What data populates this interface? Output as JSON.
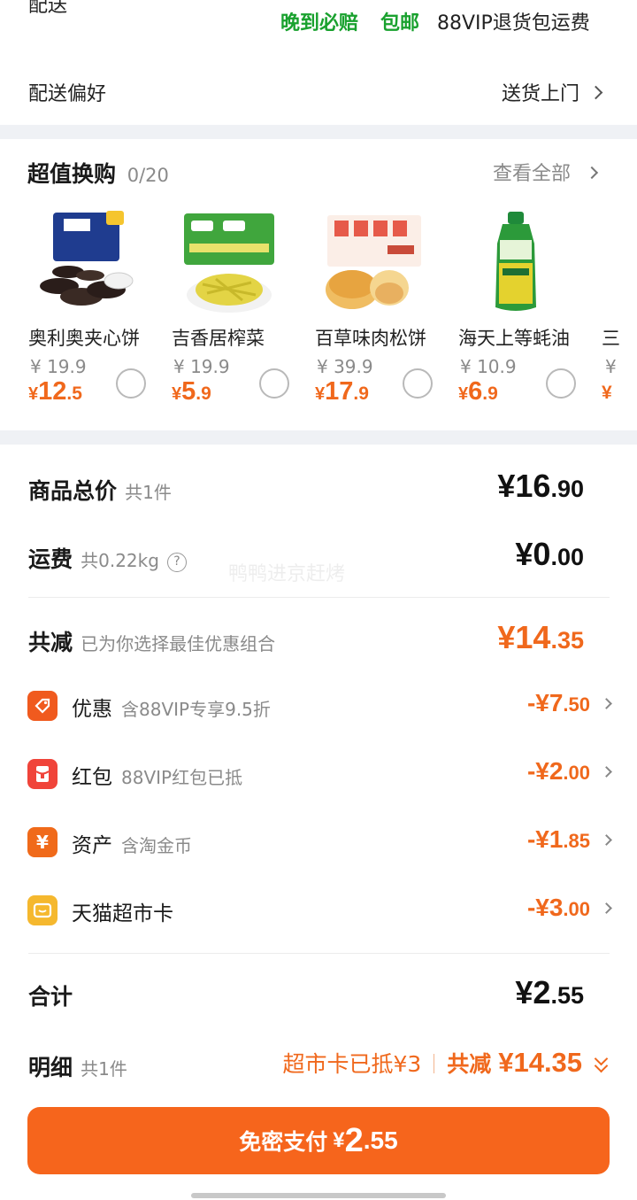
{
  "delivery": {
    "label_cut": "配送",
    "tag1": "晚到必赔",
    "tag2": "包邮",
    "tag3": "88VIP退货包运费",
    "pref_label": "配送偏好",
    "pref_value": "送货上门"
  },
  "swap": {
    "title": "超值换购",
    "count": "0/20",
    "view_all": "查看全部",
    "items": [
      {
        "name": "奥利奥夹心饼",
        "old": "¥ 19.9",
        "cur_sym": "¥",
        "cur_int": "12",
        "cur_dec": ".5"
      },
      {
        "name": "吉香居榨菜",
        "old": "¥ 19.9",
        "cur_sym": "¥",
        "cur_int": "5",
        "cur_dec": ".9"
      },
      {
        "name": "百草味肉松饼",
        "old": "¥ 39.9",
        "cur_sym": "¥",
        "cur_int": "17",
        "cur_dec": ".9"
      },
      {
        "name": "海天上等蚝油",
        "old": "¥ 10.9",
        "cur_sym": "¥",
        "cur_int": "6",
        "cur_dec": ".9"
      }
    ],
    "partial_name": "三",
    "partial_old": "¥",
    "partial_cur": "¥"
  },
  "summary": {
    "total_label": "商品总价",
    "total_count": "共1件",
    "total_int": "¥16",
    "total_dec": ".90",
    "ship_label": "运费",
    "ship_weight": "共0.22kg",
    "ship_help": "?",
    "ship_int": "¥0",
    "ship_dec": ".00",
    "watermark": "鸭鸭进京赶烤",
    "reduce_label": "共减",
    "reduce_desc": "已为你选择最佳优惠组合",
    "reduce_int": "¥14",
    "reduce_dec": ".35",
    "discounts": [
      {
        "icon": "tag-icon",
        "label": "优惠",
        "desc": "含88VIP专享9.5折",
        "int": "-¥7",
        "dec": ".50",
        "color": "#f05a1e"
      },
      {
        "icon": "red-packet-icon",
        "label": "红包",
        "desc": "88VIP红包已抵",
        "int": "-¥2",
        "dec": ".00",
        "color": "#f0443a"
      },
      {
        "icon": "yuan-icon",
        "label": "资产",
        "desc": "含淘金币",
        "int": "-¥1",
        "dec": ".85",
        "color": "#f06a1a"
      },
      {
        "icon": "card-icon",
        "label": "天猫超市卡",
        "desc": "",
        "int": "-¥3",
        "dec": ".00",
        "color": "#f5b82e"
      }
    ],
    "sum_label": "合计",
    "sum_int": "¥2",
    "sum_dec": ".55"
  },
  "detail": {
    "label": "明细",
    "count": "共1件",
    "card_used": "超市卡已抵¥3",
    "reduce_label": "共减",
    "reduce_value": "¥14.35"
  },
  "pay": {
    "label": "免密支付",
    "sym": "¥",
    "int": "2",
    "dec": ".55"
  }
}
